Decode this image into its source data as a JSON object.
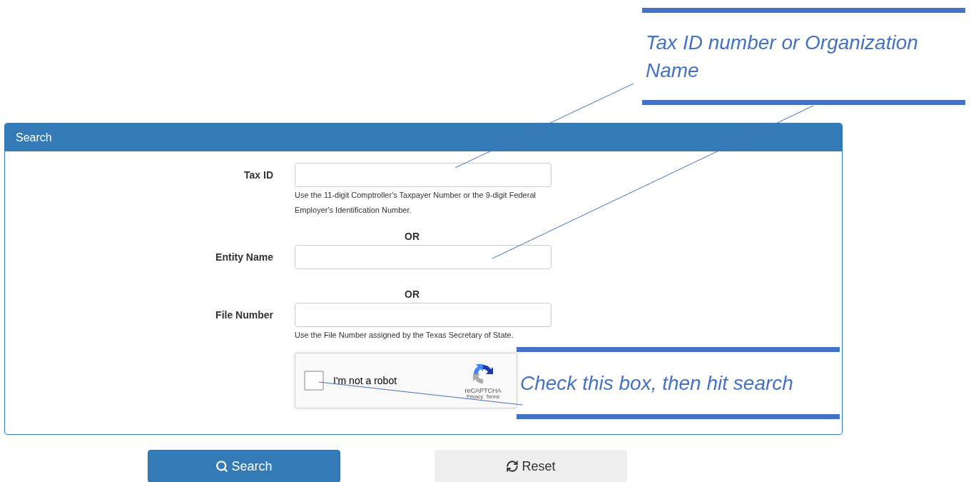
{
  "panel": {
    "title": "Search"
  },
  "rows": [
    {
      "kind": "field",
      "label": "Tax ID",
      "help": "Use the 11-digit Comptroller's Taxpayer Number or the 9-digit Federal Employer's Identification Number."
    },
    {
      "kind": "separator",
      "text": "OR"
    },
    {
      "kind": "field",
      "label": "Entity Name"
    },
    {
      "kind": "separator",
      "text": "OR"
    },
    {
      "kind": "field",
      "label": "File Number",
      "help": "Use the File Number assigned by the Texas Secretary of State."
    }
  ],
  "captcha": {
    "label": "I'm not a robot",
    "checked": false,
    "brand": "reCAPTCHA",
    "links": [
      "Privacy",
      "Terms"
    ]
  },
  "buttons": [
    {
      "label": "Search",
      "kind": "primary"
    },
    {
      "label": "Reset",
      "kind": "default"
    }
  ],
  "annotations": [
    {
      "text": "Tax ID number or Organization Name"
    },
    {
      "text": "Check this box, then hit search"
    }
  ]
}
